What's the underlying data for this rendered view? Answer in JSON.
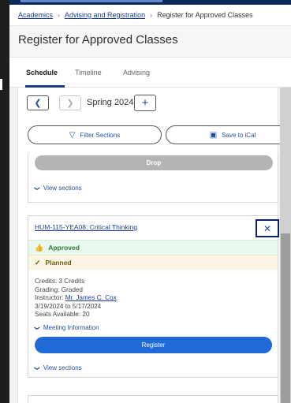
{
  "breadcrumb": {
    "items": [
      "Academics",
      "Advising and Registration"
    ],
    "current": "Register for Approved Classes"
  },
  "page": {
    "title": "Register for Approved Classes"
  },
  "tabs": [
    {
      "label": "Schedule",
      "active": true
    },
    {
      "label": "Timeline",
      "active": false
    },
    {
      "label": "Advising",
      "active": false
    }
  ],
  "term": {
    "label": "Spring 2024"
  },
  "actions": {
    "filter_label": "Filter Sections",
    "ical_label": "Save to iCal"
  },
  "prev_card": {
    "drop_label": "Drop",
    "view_sections": "View sections"
  },
  "course": {
    "title": "HUM-115-YEA08: Critical Thinking",
    "approved_label": "Approved",
    "planned_label": "Planned",
    "credits": "Credits: 3 Credits",
    "grading": "Grading: Graded",
    "instructor_prefix": "Instructor:",
    "instructor_name": "Mr. James C. Cox",
    "dates": "3/19/2024 to 5/17/2024",
    "seats": "Seats Available:  20",
    "meeting_link": "Meeting Information",
    "register_label": "Register",
    "view_sections": "View sections"
  },
  "colors": {
    "primary": "#1f6ad7",
    "link": "#1a3e8c",
    "approved": "#2e7d32",
    "planned": "#6e5b1a",
    "header_band": "#0b2a57"
  },
  "icons": {
    "prev": "chevron-left-icon",
    "next": "chevron-right-icon",
    "add": "plus-icon",
    "filter": "filter-icon",
    "calendar": "calendar-icon",
    "close": "close-icon",
    "approved": "thumbs-up-icon",
    "planned": "checkmark-icon",
    "expand": "chevron-down-icon"
  }
}
